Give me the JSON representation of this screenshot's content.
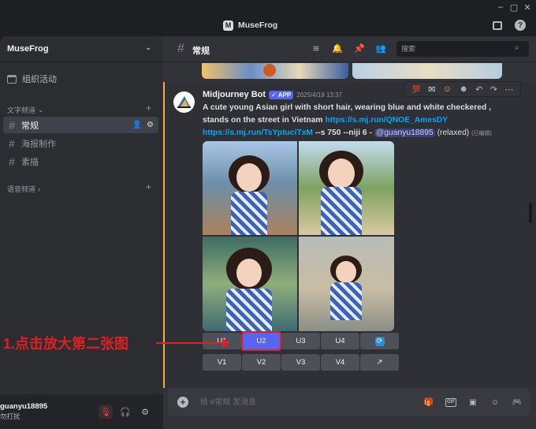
{
  "window": {
    "app_logo": "M",
    "title": "MuseFrog",
    "icons": [
      "inbox-icon",
      "help-icon"
    ]
  },
  "sidebar": {
    "server_name": "MuseFrog",
    "events_label": "组织活动",
    "text_category": "文字频道",
    "voice_category": "语音频道",
    "channels": [
      {
        "name": "常规",
        "active": true
      },
      {
        "name": "海报制作",
        "active": false
      },
      {
        "name": "素描",
        "active": false
      }
    ],
    "user": {
      "name": "guanyu18895",
      "status": "勿打扰"
    }
  },
  "channel": {
    "name": "常规",
    "search_placeholder": "搜索"
  },
  "message": {
    "author": "Midjourney Bot",
    "badge": "APP",
    "timestamp": "2025/4/19 13:37",
    "prompt": "A cute young Asian girl with short hair, wearing blue and white checkered , stands on the street in Vietnam",
    "link1": "https://s.mj.run/QNOE_AmesDY",
    "link2": "https://s.mj.run/TsYptuciTxM",
    "params": "--s 750 --niji 6",
    "separator": "-",
    "mention": "@guanyu18895",
    "mode": "(relaxed)",
    "edited": "(已编辑)"
  },
  "buttons": {
    "row1": [
      "U1",
      "U2",
      "U3",
      "U4"
    ],
    "row2": [
      "V1",
      "V2",
      "V3",
      "V4"
    ]
  },
  "composer": {
    "placeholder": "给 #常规 发消息"
  },
  "annotation": {
    "text": "1.点击放大第二张图",
    "color": "#e02020"
  },
  "colors": {
    "accent": "#5865f2",
    "link": "#00a8fc",
    "highlight_border": "#f0b232"
  }
}
